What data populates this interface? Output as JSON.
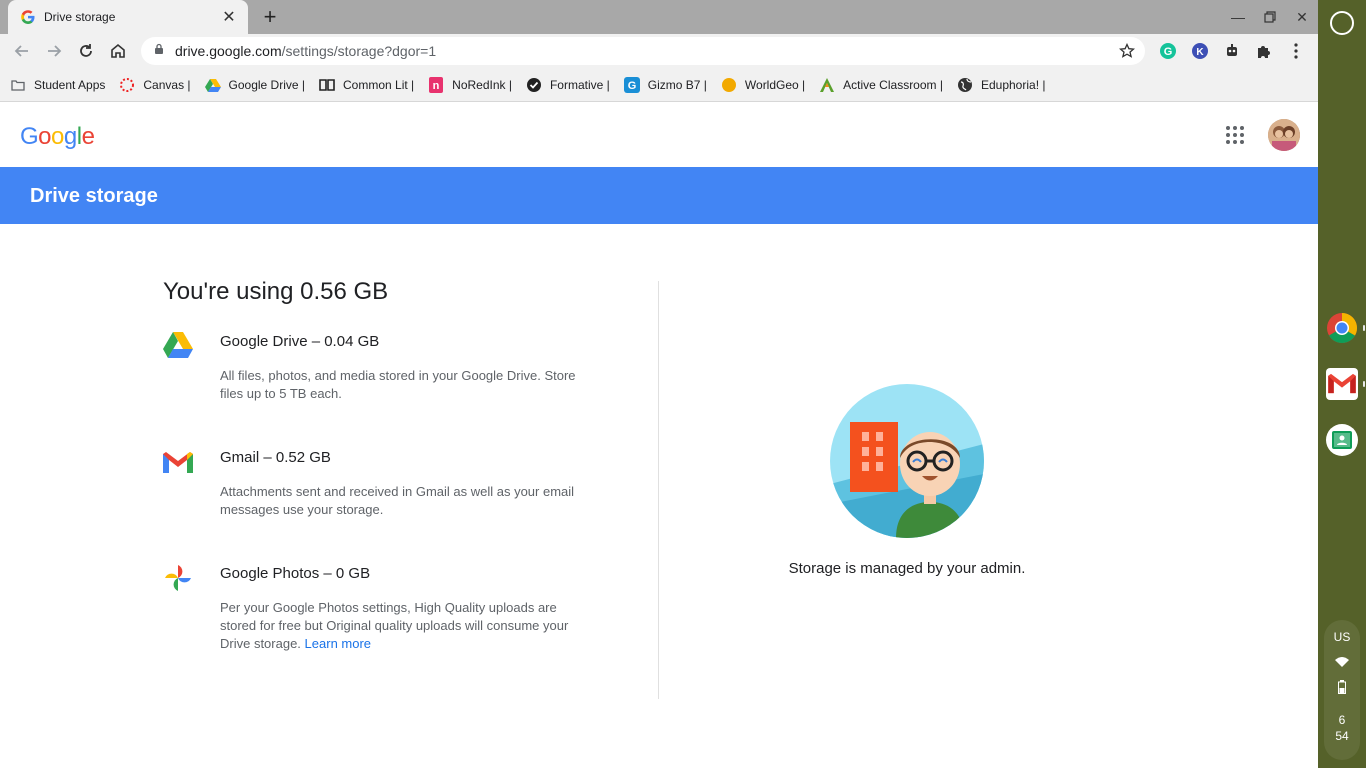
{
  "browser": {
    "tab": {
      "title": "Drive storage",
      "icon": "google-g-icon"
    },
    "new_tab_label": "+",
    "window_controls": [
      "minimize-icon",
      "restore-icon",
      "close-icon"
    ],
    "address_bar": {
      "domain": "drive.google.com",
      "path": "/settings/storage?dgor=1",
      "lock_icon": "lock-icon"
    },
    "bookmarks": [
      {
        "label": "Student Apps",
        "icon": "folder-icon"
      },
      {
        "label": "Canvas |",
        "icon": "canvas-icon"
      },
      {
        "label": "Google Drive |",
        "icon": "google-drive-icon"
      },
      {
        "label": "Common Lit |",
        "icon": "book-icon"
      },
      {
        "label": "NoRedInk |",
        "icon": "noredink-icon"
      },
      {
        "label": "Formative |",
        "icon": "formative-icon"
      },
      {
        "label": "Gizmo B7 |",
        "icon": "gizmo-icon"
      },
      {
        "label": "WorldGeo |",
        "icon": "worldgeo-icon"
      },
      {
        "label": "Active Classroom |",
        "icon": "active-classroom-icon"
      },
      {
        "label": "Eduphoria! |",
        "icon": "globe-icon"
      }
    ]
  },
  "page": {
    "logo": {
      "letters": [
        "G",
        "o",
        "o",
        "g",
        "l",
        "e"
      ],
      "colors": [
        "#4285f4",
        "#ea4335",
        "#fbbc05",
        "#4285f4",
        "#34a853",
        "#ea4335"
      ]
    },
    "banner_title": "Drive storage",
    "usage_title": "You're using 0.56 GB",
    "items": [
      {
        "name": "Google Drive – 0.04 GB",
        "description": "All files, photos, and media stored in your Google Drive. Store files up to 5 TB each.",
        "icon": "google-drive-icon"
      },
      {
        "name": "Gmail – 0.52 GB",
        "description": "Attachments sent and received in Gmail as well as your email messages use your storage.",
        "icon": "gmail-icon"
      },
      {
        "name": "Google Photos – 0 GB",
        "description": "Per your Google Photos settings, High Quality uploads are stored for free but Original quality uploads will consume your Drive storage.",
        "link_text": "Learn more",
        "icon": "google-photos-icon"
      }
    ],
    "admin_message": "Storage is managed by your admin.",
    "colors": {
      "banner": "#4285f4",
      "link": "#1a73e8"
    }
  },
  "shelf": {
    "apps": [
      "chrome-icon",
      "gmail-icon",
      "google-classroom-icon"
    ],
    "tray": {
      "locale": "US",
      "time_hour": "6",
      "time_minute": "54"
    }
  }
}
